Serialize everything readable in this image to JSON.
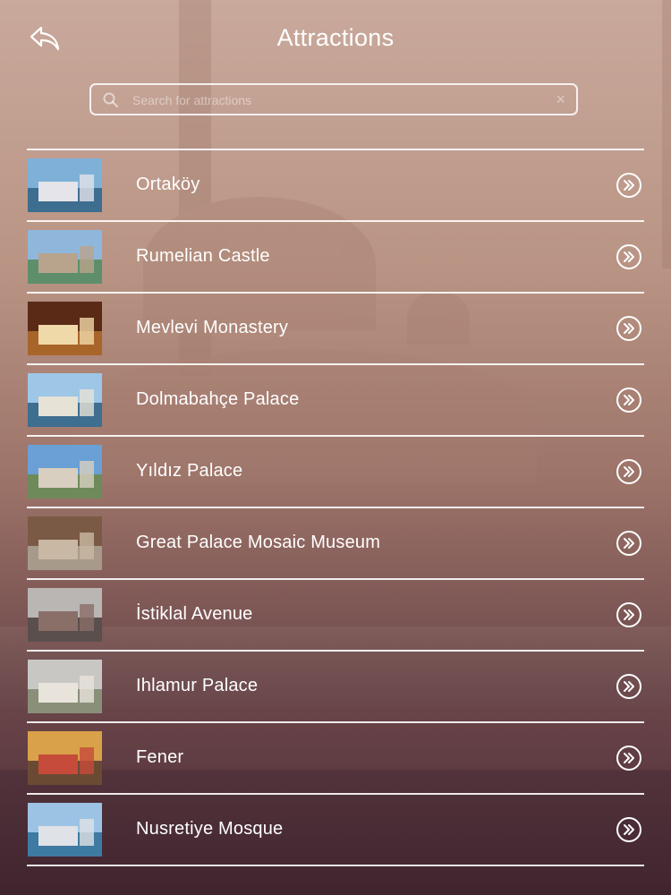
{
  "header": {
    "title": "Attractions"
  },
  "search": {
    "placeholder": "Search for attractions"
  },
  "attractions": [
    {
      "name": "Ortaköy",
      "sky": "#7fb1d8",
      "ground": "#3d6d8f",
      "bld": "#e4e4ea"
    },
    {
      "name": "Rumelian Castle",
      "sky": "#8fb7dc",
      "ground": "#5e8f6a",
      "bld": "#b8a48c"
    },
    {
      "name": "Mevlevi Monastery",
      "sky": "#5a2a16",
      "ground": "#a8652a",
      "bld": "#f0d9a8"
    },
    {
      "name": "Dolmabahçe Palace",
      "sky": "#9ec6e6",
      "ground": "#3e6e90",
      "bld": "#e7e2d6"
    },
    {
      "name": "Yıldız Palace",
      "sky": "#6aa0d6",
      "ground": "#6f8a5a",
      "bld": "#d8cfc0"
    },
    {
      "name": "Great Palace Mosaic Museum",
      "sky": "#7a5a45",
      "ground": "#a79a8a",
      "bld": "#c9b8a3"
    },
    {
      "name": "İstiklal Avenue",
      "sky": "#b9b6b3",
      "ground": "#5a4f4c",
      "bld": "#8a6e68"
    },
    {
      "name": "Ihlamur Palace",
      "sky": "#c8c7c4",
      "ground": "#8a8f7a",
      "bld": "#e8e4dc"
    },
    {
      "name": "Fener",
      "sky": "#d9a24a",
      "ground": "#6b4a34",
      "bld": "#c64b3a"
    },
    {
      "name": "Nusretiye Mosque",
      "sky": "#9cc3e4",
      "ground": "#3f7aa2",
      "bld": "#dfe2e6"
    }
  ]
}
